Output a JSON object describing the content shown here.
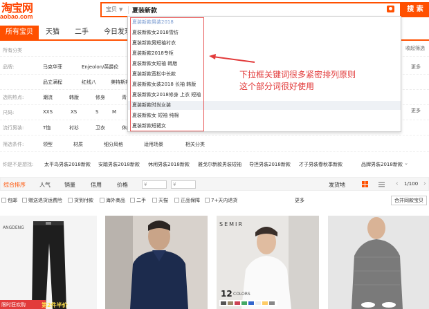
{
  "header": {
    "logo_line1": "淘宝网",
    "logo_line2": "aobao.com",
    "search_category": "宝贝",
    "search_value": "夏装新款",
    "search_button": "搜 索"
  },
  "tabs": [
    "所有宝贝",
    "天猫",
    "二手",
    "今日发现"
  ],
  "filter": {
    "all_categories": "所有分类",
    "expand": "收起筛选",
    "more": "更多",
    "rows": [
      {
        "label": "品牌:",
        "values": [
          "马克华菲",
          "Enjeolon/英爵伦"
        ]
      },
      {
        "label": "",
        "values": [
          "品立满程",
          "红线八",
          "美特斯邦威"
        ]
      },
      {
        "label": "选购热点:",
        "values": [
          "潮流",
          "韩版",
          "修身",
          "青"
        ]
      },
      {
        "label": "尺码:",
        "values": [
          "XXS",
          "XS",
          "S",
          "M"
        ]
      },
      {
        "label": "流行男装:",
        "values": [
          "T恤",
          "衬衫",
          "卫衣",
          "休闲"
        ]
      },
      {
        "label": "筛选条件:",
        "values": [
          "领型",
          "材质",
          "细分风格",
          "适用场景",
          "相关分类"
        ]
      }
    ]
  },
  "dropdown": {
    "items": [
      "夏装新款男装2018",
      "夏装新款女2018雪纺",
      "夏装新款男短袖衬衣",
      "夏装新款2018专柜",
      "夏装新款女短袖 韩版",
      "夏装新款宽松中长款",
      "夏装新款女装2018 长袖 韩版",
      "夏装新款女2018修身 上衣 短袖",
      "夏装新款时尚女装",
      "夏装新款女 短袖 纯棉",
      "夏装新款短裙女"
    ]
  },
  "annotation": {
    "line1": "下拉框关键词很多紧密排列原则",
    "line2": "这个部分词很好使用"
  },
  "related": {
    "label": "你是不是想找:",
    "items": [
      "太平鸟男装2018新款",
      "安踏男装2018新款",
      "休闲男装2018新款",
      "雅戈尔新款男装短袖",
      "导担男装2018新款",
      "才子男装春秋季新款",
      "品牌男装2018新款"
    ]
  },
  "sortbar": {
    "items": [
      "综合排序",
      "人气",
      "销量",
      "信用",
      "价格"
    ],
    "price_from": "¥",
    "price_to": "¥",
    "shipping": "发货地",
    "page": "1/100"
  },
  "options": {
    "items": [
      "包邮",
      "赠送退货运费险",
      "货到付款",
      "海外商品",
      "二手",
      "天猫",
      "正品保障",
      "7+天内退货"
    ],
    "more": "更多",
    "merge": "合并同款宝贝"
  },
  "products": {
    "brand_tag": "ANGDENG",
    "semir": "SEMIR",
    "colors_num": "12",
    "colors_txt": "COLORS",
    "promo1": "限时狂欢购",
    "promo2": "第2件半价"
  },
  "colors": {
    "accent": "#ff5000",
    "annotation": "#e23b3b"
  }
}
